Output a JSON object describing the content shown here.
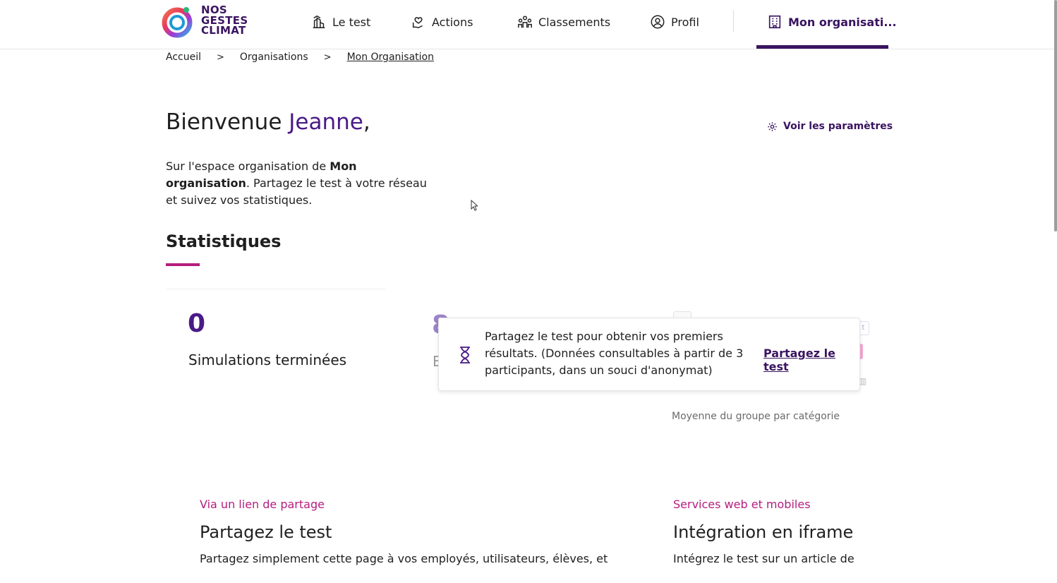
{
  "header": {
    "logo_lines": [
      "NOS",
      "GESTES",
      "CLIMAT"
    ],
    "nav": [
      {
        "label": "Le test",
        "icon": "chart-building-icon"
      },
      {
        "label": "Actions",
        "icon": "hand-heart-icon"
      },
      {
        "label": "Classements",
        "icon": "people-group-icon"
      },
      {
        "label": "Profil",
        "icon": "user-circle-icon"
      },
      {
        "label": "Mon organisati...",
        "icon": "office-building-icon",
        "active": true
      }
    ]
  },
  "breadcrumb": {
    "items": [
      "Accueil",
      "Organisations",
      "Mon Organisation"
    ],
    "separator": ">"
  },
  "welcome": {
    "prefix": "Bienvenue ",
    "name": "Jeanne",
    "suffix": ","
  },
  "settings_link": "Voir les paramètres",
  "intro": {
    "part1": "Sur l'espace organisation de ",
    "org_name": "Mon organisation",
    "part2": ". Partagez le test à votre réseau et suivez vos statistiques."
  },
  "stats": {
    "title": "Statistiques",
    "simulations_value": "0",
    "simulations_label": "Simulations terminées",
    "second_value_partial": "8",
    "second_label_partial": "E",
    "chart_caption": "Moyenne du groupe par catégorie"
  },
  "toast": {
    "message": "Partagez le test pour obtenir vos premiers résultats. (Données consultables à partir de 3 participants, dans un souci d'anonymat)",
    "link": "Partagez le test"
  },
  "share_cards": [
    {
      "eyebrow": "Via un lien de partage",
      "title": "Partagez le test",
      "description": "Partagez simplement cette page à vos employés, utilisateurs, élèves, et"
    },
    {
      "eyebrow": "Services web et mobiles",
      "title": "Intégration en iframe",
      "description": "Intégrez le test sur un article de"
    }
  ],
  "colors": {
    "brand_purple": "#3a1460",
    "accent_purple": "#4a1a87",
    "accent_pink": "#b51d7e"
  }
}
